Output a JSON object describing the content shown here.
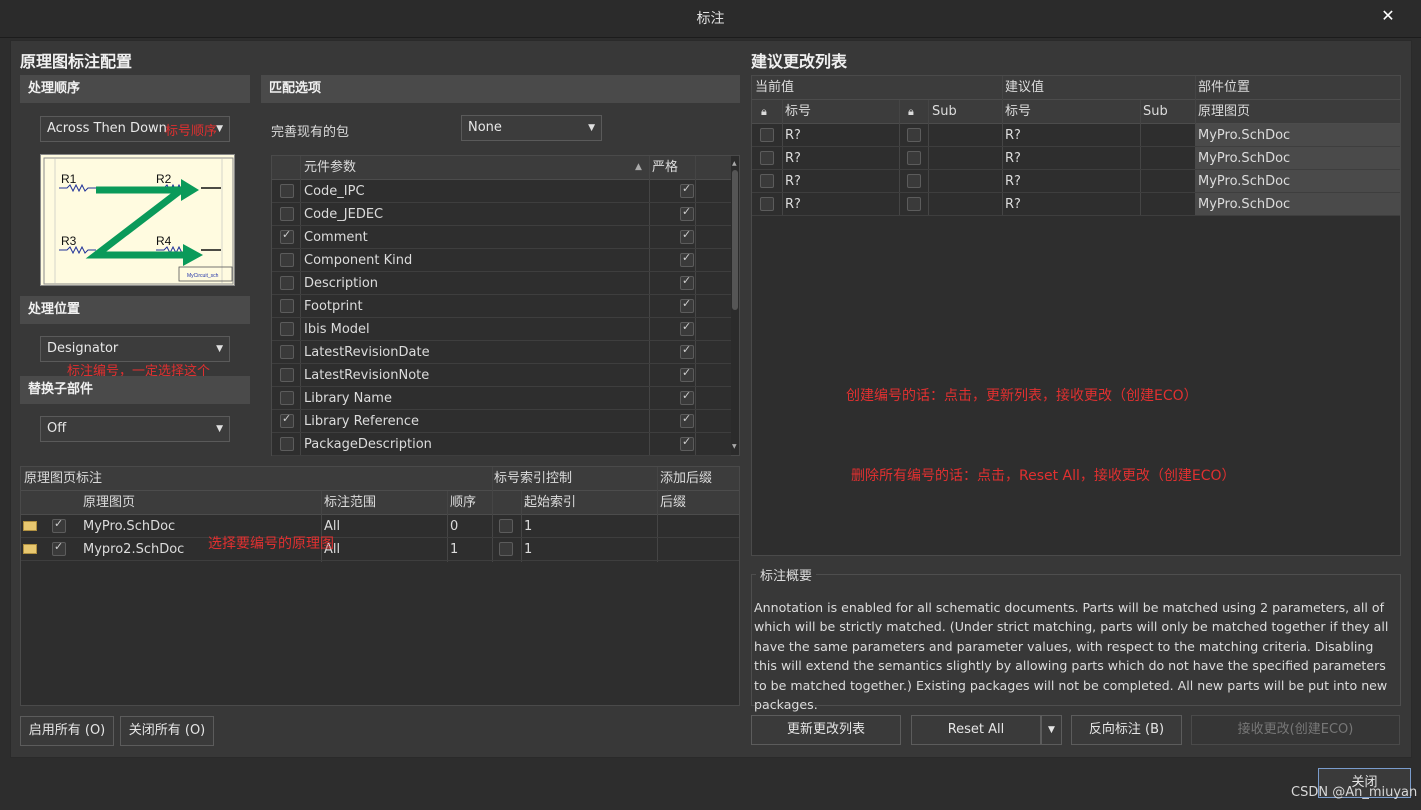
{
  "window": {
    "title": "标注",
    "close_glyph": "✕"
  },
  "left": {
    "title": "原理图标注配置",
    "order": {
      "header": "处理顺序",
      "combo_value": "Across Then Down",
      "note": "标号顺序",
      "diagram": {
        "labels": [
          "R1",
          "R2",
          "R3",
          "R4"
        ],
        "stamp": "MyCircuit_sch",
        "arrow_color": "#0a9a5a",
        "bg": "#fffbe0"
      }
    },
    "location": {
      "header": "处理位置",
      "combo_value": "Designator",
      "note": "标注编号，一定选择这个"
    },
    "subpart": {
      "header": "替换子部件",
      "combo_value": "Off"
    },
    "match": {
      "header": "匹配选项",
      "pkg_label": "完善现有的包",
      "pkg_value": "None",
      "col_param": "元件参数",
      "col_strict": "严格",
      "params": [
        {
          "name": "Code_IPC",
          "checked": false
        },
        {
          "name": "Code_JEDEC",
          "checked": false
        },
        {
          "name": "Comment",
          "checked": true
        },
        {
          "name": "Component Kind",
          "checked": false
        },
        {
          "name": "Description",
          "checked": false
        },
        {
          "name": "Footprint",
          "checked": false
        },
        {
          "name": "Ibis Model",
          "checked": false
        },
        {
          "name": "LatestRevisionDate",
          "checked": false
        },
        {
          "name": "LatestRevisionNote",
          "checked": false
        },
        {
          "name": "Library Name",
          "checked": false
        },
        {
          "name": "Library Reference",
          "checked": true
        },
        {
          "name": "PackageDescription",
          "checked": false
        }
      ]
    },
    "sheets": {
      "hdr_group_1": "原理图页标注",
      "hdr_group_2": "标号索引控制",
      "hdr_group_3": "添加后缀",
      "col_sheet": "原理图页",
      "col_scope": "标注范围",
      "col_order": "顺序",
      "col_start": "起始索引",
      "col_suffix": "后缀",
      "rows": [
        {
          "sheet": "MyPro.SchDoc",
          "scope": "All",
          "order": "0",
          "start": "1"
        },
        {
          "sheet": "Mypro2.SchDoc",
          "scope": "All",
          "order": "1",
          "start": "1"
        }
      ],
      "note": "选择要编号的原理图"
    },
    "buttons": {
      "enable_all": "启用所有 (O)",
      "disable_all": "关闭所有 (O)"
    }
  },
  "right": {
    "title": "建议更改列表",
    "grp_current": "当前值",
    "grp_proposed": "建议值",
    "grp_location": "部件位置",
    "col_designator": "标号",
    "col_sub": "Sub",
    "col_sheet": "原理图页",
    "rows": [
      {
        "current": "R?",
        "proposed": "R?",
        "sheet": "MyPro.SchDoc"
      },
      {
        "current": "R?",
        "proposed": "R?",
        "sheet": "MyPro.SchDoc"
      },
      {
        "current": "R?",
        "proposed": "R?",
        "sheet": "MyPro.SchDoc"
      },
      {
        "current": "R?",
        "proposed": "R?",
        "sheet": "MyPro.SchDoc"
      }
    ],
    "note_create": "创建编号的话：点击，更新列表，接收更改（创建ECO）",
    "note_delete": "删除所有编号的话：点击，Reset All，接收更改（创建ECO）",
    "summary": {
      "title": "标注概要",
      "text": "Annotation is enabled for all schematic documents. Parts will be matched using 2 parameters, all of which will be strictly matched. (Under strict matching, parts will only be matched together if they all have the same parameters and parameter values, with respect to the matching criteria. Disabling this will extend the semantics slightly by allowing parts which do not have the specified parameters to be matched together.) Existing packages will not be completed. All new parts will be put into new packages."
    },
    "buttons": {
      "update": "更新更改列表",
      "reset": "Reset All",
      "back": "反向标注 (B)",
      "accept": "接收更改(创建ECO)"
    }
  },
  "footer": {
    "close": "关闭",
    "watermark": "CSDN @An_miuyan"
  },
  "colors": {
    "note_red": "#e03030",
    "diagram_arrow": "#0a9a5a"
  }
}
